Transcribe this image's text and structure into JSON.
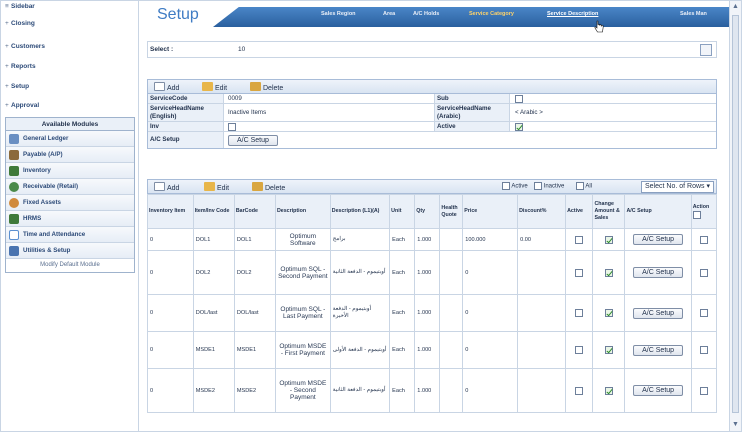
{
  "nav": {
    "links": [
      {
        "label": "Closing"
      },
      {
        "label": "Customers"
      },
      {
        "label": "Reports"
      },
      {
        "label": "Setup"
      },
      {
        "label": "Approval"
      }
    ],
    "modules_header": "Available Modules",
    "modules": [
      {
        "label": "General Ledger",
        "color": "#6a8fc2"
      },
      {
        "label": "Payable (A/P)",
        "color": "#8b6a3c"
      },
      {
        "label": "Inventory",
        "color": "#3f7a3a"
      },
      {
        "label": "Receivable (Retail)",
        "color": "#4a8a4a"
      },
      {
        "label": "Fixed Assets",
        "color": "#d08a3c"
      },
      {
        "label": "HRMS",
        "color": "#3f7a3a"
      },
      {
        "label": "Time and Attendance",
        "color": "#5a8fd0"
      },
      {
        "label": "Utilities & Setup",
        "color": "#4a74b0"
      }
    ],
    "modify_label": "Modify Default Module"
  },
  "header": {
    "title": "Setup",
    "tabs": [
      {
        "label": "Sales Region"
      },
      {
        "label": "Area"
      },
      {
        "label": "A/C Holds"
      },
      {
        "label": "Service Category"
      },
      {
        "label": "Service Description"
      },
      {
        "label": "Sales Man"
      }
    ]
  },
  "select": {
    "label": "Select :",
    "value": "10"
  },
  "toolbar": {
    "add": "Add",
    "edit": "Edit",
    "delete": "Delete"
  },
  "form": {
    "service_code_label": "ServiceCode",
    "service_code_value": "0009",
    "sub_label": "Sub",
    "head_en_label": "ServiceHeadName (English)",
    "head_en_value": "Inactive Items",
    "head_ar_label": "ServiceHeadName (Arabic)",
    "head_ar_value": "< Arabic >",
    "inv_label": "Inv",
    "active_label": "Active",
    "ac_setup_label": "A/C Setup",
    "ac_setup_button": "A/C Setup"
  },
  "grid_toolbar": {
    "add": "Add",
    "edit": "Edit",
    "delete": "Delete",
    "active": "Active",
    "inactive": "Inactive",
    "all": "All",
    "rows_select": "Select No. of Rows"
  },
  "grid": {
    "headers": [
      "Inventory Item",
      "Item/Inv Code",
      "BarCode",
      "Description",
      "Description (L1)(A)",
      "Unit",
      "Qty",
      "Health Quote",
      "Price",
      "Discount%",
      "Active",
      "Change Amount & Sales",
      "A/C Setup",
      "Action"
    ],
    "rows": [
      {
        "inv": "0",
        "code": "DOL1",
        "barcode": "DOL1",
        "desc": "Optimum Software",
        "ar": "برامج",
        "unit": "Each",
        "qty": "1.000",
        "price": "100.000",
        "disc": "0.00",
        "active": false,
        "change": true,
        "ac": "A/C Setup"
      },
      {
        "inv": "0",
        "code": "DOL2",
        "barcode": "DOL2",
        "desc": "Optimum SQL - Second Payment",
        "ar": "أوبتيموم - الدفعة الثانية",
        "unit": "Each",
        "qty": "1.000",
        "price": "0",
        "disc": "",
        "active": false,
        "change": true,
        "ac": "A/C Setup"
      },
      {
        "inv": "0",
        "code": "DOL/last",
        "barcode": "DOL/last",
        "desc": "Optimum SQL - Last Payment",
        "ar": "أوبتيموم - الدفعة الأخيرة",
        "unit": "Each",
        "qty": "1.000",
        "price": "0",
        "disc": "",
        "active": false,
        "change": true,
        "ac": "A/C Setup"
      },
      {
        "inv": "0",
        "code": "MSDE1",
        "barcode": "MSDE1",
        "desc": "Optimum MSDE - First Payment",
        "ar": "أوبتيموم - الدفعة الأولى",
        "unit": "Each",
        "qty": "1.000",
        "price": "0",
        "disc": "",
        "active": false,
        "change": true,
        "ac": "A/C Setup"
      },
      {
        "inv": "0",
        "code": "MSDE2",
        "barcode": "MSDE2",
        "desc": "Optimum MSDE - Second Payment",
        "ar": "أوبتيموم - الدفعة الثانية",
        "unit": "Each",
        "qty": "1.000",
        "price": "0",
        "disc": "",
        "active": false,
        "change": true,
        "ac": "A/C Setup"
      }
    ]
  },
  "colors": {
    "accent": "#3f7cc4",
    "tabbar": "#2a5f9e",
    "active_tab": "#ffd36a"
  }
}
